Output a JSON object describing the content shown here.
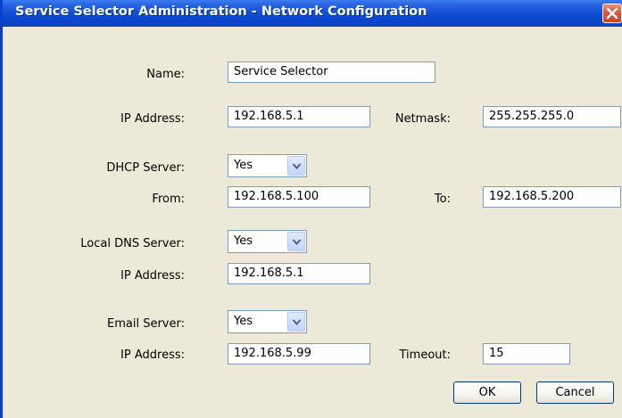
{
  "window": {
    "title": "Service Selector Administration - Network Configuration"
  },
  "form": {
    "name_label": "Name:",
    "name_value": "Service Selector",
    "ip_label": "IP Address:",
    "ip_value": "192.168.5.1",
    "netmask_label": "Netmask:",
    "netmask_value": "255.255.255.0",
    "dhcp_label": "DHCP Server:",
    "dhcp_value": "Yes",
    "dhcp_from_label": "From:",
    "dhcp_from_value": "192.168.5.100",
    "dhcp_to_label": "To:",
    "dhcp_to_value": "192.168.5.200",
    "dns_label": "Local DNS Server:",
    "dns_value": "Yes",
    "dns_ip_label": "IP Address:",
    "dns_ip_value": "192.168.5.1",
    "email_label": "Email Server:",
    "email_value": "Yes",
    "email_ip_label": "IP Address:",
    "email_ip_value": "192.168.5.99",
    "timeout_label": "Timeout:",
    "timeout_value": "15"
  },
  "buttons": {
    "ok_label": "OK",
    "cancel_label": "Cancel"
  },
  "theme": {
    "titlebar_color": "#0a45c8",
    "window_bg": "#ece9d8",
    "field_border": "#7f9db9",
    "close_button_color": "#d85a3c"
  },
  "icons": {
    "close": "close-icon",
    "dropdown": "chevron-down-icon"
  }
}
